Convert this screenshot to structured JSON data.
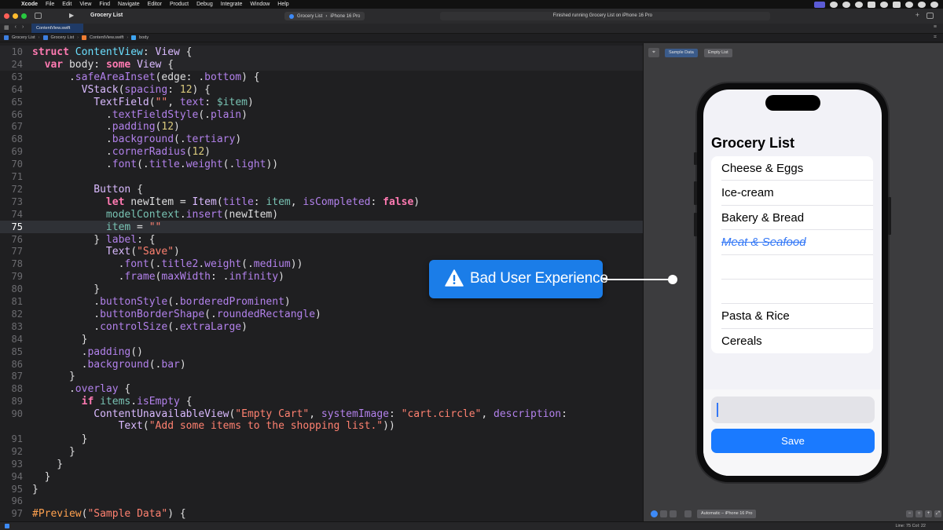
{
  "menubar": {
    "app": "Xcode",
    "items": [
      "File",
      "Edit",
      "View",
      "Find",
      "Navigate",
      "Editor",
      "Product",
      "Debug",
      "Integrate",
      "Window",
      "Help"
    ]
  },
  "toolbar": {
    "project": "Grocery List",
    "scheme": "Grocery List",
    "destination": "iPhone 16 Pro",
    "status": "Finished running Grocery List on iPhone 16 Pro"
  },
  "tabbar": {
    "tab": "ContentView.swift"
  },
  "jumpbar": {
    "crumbs": [
      "Grocery List",
      "Grocery List",
      "ContentView.swift",
      "body"
    ]
  },
  "editor": {
    "current_line": 75,
    "lines": [
      {
        "n": "10",
        "sticky": true,
        "parts": [
          [
            "kw",
            "struct"
          ],
          [
            "",
            ""
          ],
          [
            "tp",
            " ContentView"
          ],
          [
            "",
            ": "
          ],
          [
            "ty",
            "View"
          ],
          [
            "",
            " {"
          ]
        ]
      },
      {
        "n": "24",
        "sticky": true,
        "parts": [
          [
            "",
            "  "
          ],
          [
            "kw",
            "var"
          ],
          [
            "",
            " body: "
          ],
          [
            "kw",
            "some"
          ],
          [
            "ty",
            " View"
          ],
          [
            "",
            " {"
          ]
        ]
      },
      {
        "n": "63",
        "parts": [
          [
            "",
            "      ."
          ],
          [
            "mt",
            "safeAreaInset"
          ],
          [
            "",
            "(edge: ."
          ],
          [
            "mt",
            "bottom"
          ],
          [
            "",
            ") {"
          ]
        ]
      },
      {
        "n": "64",
        "parts": [
          [
            "",
            "        "
          ],
          [
            "ty",
            "VStack"
          ],
          [
            "",
            "("
          ],
          [
            "mt",
            "spacing"
          ],
          [
            "",
            ": "
          ],
          [
            "nm",
            "12"
          ],
          [
            "",
            ") {"
          ]
        ]
      },
      {
        "n": "65",
        "parts": [
          [
            "",
            "          "
          ],
          [
            "ty",
            "TextField"
          ],
          [
            "",
            "("
          ],
          [
            "st",
            "\"\""
          ],
          [
            "",
            ", "
          ],
          [
            "mt",
            "text"
          ],
          [
            "",
            ": "
          ],
          [
            "dp",
            "$item"
          ],
          [
            "",
            ")"
          ]
        ]
      },
      {
        "n": "66",
        "parts": [
          [
            "",
            "            ."
          ],
          [
            "mt",
            "textFieldStyle"
          ],
          [
            "",
            "(."
          ],
          [
            "mt",
            "plain"
          ],
          [
            "",
            ")"
          ]
        ]
      },
      {
        "n": "67",
        "parts": [
          [
            "",
            "            ."
          ],
          [
            "mt",
            "padding"
          ],
          [
            "",
            "("
          ],
          [
            "nm",
            "12"
          ],
          [
            "",
            ")"
          ]
        ]
      },
      {
        "n": "68",
        "parts": [
          [
            "",
            "            ."
          ],
          [
            "mt",
            "background"
          ],
          [
            "",
            "(."
          ],
          [
            "mt",
            "tertiary"
          ],
          [
            "",
            ")"
          ]
        ]
      },
      {
        "n": "69",
        "parts": [
          [
            "",
            "            ."
          ],
          [
            "mt",
            "cornerRadius"
          ],
          [
            "",
            "("
          ],
          [
            "nm",
            "12"
          ],
          [
            "",
            ")"
          ]
        ]
      },
      {
        "n": "70",
        "parts": [
          [
            "",
            "            ."
          ],
          [
            "mt",
            "font"
          ],
          [
            "",
            "(."
          ],
          [
            "mt",
            "title"
          ],
          [
            "",
            "."
          ],
          [
            "mt",
            "weight"
          ],
          [
            "",
            "(."
          ],
          [
            "mt",
            "light"
          ],
          [
            "",
            "))"
          ]
        ]
      },
      {
        "n": "71",
        "parts": [
          [
            "",
            ""
          ]
        ]
      },
      {
        "n": "72",
        "parts": [
          [
            "",
            "          "
          ],
          [
            "ty",
            "Button"
          ],
          [
            "",
            " {"
          ]
        ]
      },
      {
        "n": "73",
        "parts": [
          [
            "",
            "            "
          ],
          [
            "kw",
            "let"
          ],
          [
            "",
            " newItem = "
          ],
          [
            "ty",
            "Item"
          ],
          [
            "",
            "("
          ],
          [
            "mt",
            "title"
          ],
          [
            "",
            ": "
          ],
          [
            "dp",
            "item"
          ],
          [
            "",
            ", "
          ],
          [
            "mt",
            "isCompleted"
          ],
          [
            "",
            ": "
          ],
          [
            "kw",
            "false"
          ],
          [
            "",
            ")"
          ]
        ]
      },
      {
        "n": "74",
        "parts": [
          [
            "",
            "            "
          ],
          [
            "dp",
            "modelContext"
          ],
          [
            "",
            "."
          ],
          [
            "mt",
            "insert"
          ],
          [
            "",
            "(newItem)"
          ]
        ]
      },
      {
        "n": "75",
        "current": true,
        "parts": [
          [
            "",
            "            "
          ],
          [
            "dp",
            "item"
          ],
          [
            "",
            " = "
          ],
          [
            "st",
            "\"\""
          ]
        ]
      },
      {
        "n": "76",
        "parts": [
          [
            "",
            "          } "
          ],
          [
            "mt",
            "label"
          ],
          [
            "",
            ": {"
          ]
        ]
      },
      {
        "n": "77",
        "parts": [
          [
            "",
            "            "
          ],
          [
            "ty",
            "Text"
          ],
          [
            "",
            "("
          ],
          [
            "st",
            "\"Save\""
          ],
          [
            "",
            ")"
          ]
        ]
      },
      {
        "n": "78",
        "parts": [
          [
            "",
            "              ."
          ],
          [
            "mt",
            "font"
          ],
          [
            "",
            "(."
          ],
          [
            "mt",
            "title2"
          ],
          [
            "",
            "."
          ],
          [
            "mt",
            "weight"
          ],
          [
            "",
            "(."
          ],
          [
            "mt",
            "medium"
          ],
          [
            "",
            "))"
          ]
        ]
      },
      {
        "n": "79",
        "parts": [
          [
            "",
            "              ."
          ],
          [
            "mt",
            "frame"
          ],
          [
            "",
            "("
          ],
          [
            "mt",
            "maxWidth"
          ],
          [
            "",
            ": ."
          ],
          [
            "mt",
            "infinity"
          ],
          [
            "",
            ")"
          ]
        ]
      },
      {
        "n": "80",
        "parts": [
          [
            "",
            "          }"
          ]
        ]
      },
      {
        "n": "81",
        "parts": [
          [
            "",
            "          ."
          ],
          [
            "mt",
            "buttonStyle"
          ],
          [
            "",
            "(."
          ],
          [
            "mt",
            "borderedProminent"
          ],
          [
            "",
            ")"
          ]
        ]
      },
      {
        "n": "82",
        "parts": [
          [
            "",
            "          ."
          ],
          [
            "mt",
            "buttonBorderShape"
          ],
          [
            "",
            "(."
          ],
          [
            "mt",
            "roundedRectangle"
          ],
          [
            "",
            ")"
          ]
        ]
      },
      {
        "n": "83",
        "parts": [
          [
            "",
            "          ."
          ],
          [
            "mt",
            "controlSize"
          ],
          [
            "",
            "(."
          ],
          [
            "mt",
            "extraLarge"
          ],
          [
            "",
            ")"
          ]
        ]
      },
      {
        "n": "84",
        "parts": [
          [
            "",
            "        }"
          ]
        ]
      },
      {
        "n": "85",
        "parts": [
          [
            "",
            "        ."
          ],
          [
            "mt",
            "padding"
          ],
          [
            "",
            "()"
          ]
        ]
      },
      {
        "n": "86",
        "parts": [
          [
            "",
            "        ."
          ],
          [
            "mt",
            "background"
          ],
          [
            "",
            "(."
          ],
          [
            "mt",
            "bar"
          ],
          [
            "",
            ")"
          ]
        ]
      },
      {
        "n": "87",
        "parts": [
          [
            "",
            "      }"
          ]
        ]
      },
      {
        "n": "88",
        "parts": [
          [
            "",
            "      ."
          ],
          [
            "mt",
            "overlay"
          ],
          [
            "",
            " {"
          ]
        ]
      },
      {
        "n": "89",
        "parts": [
          [
            "",
            "        "
          ],
          [
            "kw",
            "if"
          ],
          [
            "",
            " "
          ],
          [
            "dp",
            "items"
          ],
          [
            "",
            "."
          ],
          [
            "mt",
            "isEmpty"
          ],
          [
            "",
            " {"
          ]
        ]
      },
      {
        "n": "90",
        "parts": [
          [
            "",
            "          "
          ],
          [
            "ty",
            "ContentUnavailableView"
          ],
          [
            "",
            "("
          ],
          [
            "st",
            "\"Empty Cart\""
          ],
          [
            "",
            ", "
          ],
          [
            "mt",
            "systemImage"
          ],
          [
            "",
            ": "
          ],
          [
            "st",
            "\"cart.circle\""
          ],
          [
            "",
            ", "
          ],
          [
            "mt",
            "description"
          ],
          [
            "",
            ":"
          ]
        ]
      },
      {
        "n": "",
        "parts": [
          [
            "",
            "              "
          ],
          [
            "ty",
            "Text"
          ],
          [
            "",
            "("
          ],
          [
            "st",
            "\"Add some items to the shopping list.\""
          ],
          [
            "",
            "))"
          ]
        ]
      },
      {
        "n": "91",
        "parts": [
          [
            "",
            "        }"
          ]
        ]
      },
      {
        "n": "92",
        "parts": [
          [
            "",
            "      }"
          ]
        ]
      },
      {
        "n": "93",
        "parts": [
          [
            "",
            "    }"
          ]
        ]
      },
      {
        "n": "94",
        "parts": [
          [
            "",
            "  }"
          ]
        ]
      },
      {
        "n": "95",
        "parts": [
          [
            "",
            "}"
          ]
        ]
      },
      {
        "n": "96",
        "parts": [
          [
            "",
            ""
          ]
        ]
      },
      {
        "n": "97",
        "parts": [
          [
            "at",
            "#Preview"
          ],
          [
            "",
            "("
          ],
          [
            "st",
            "\"Sample Data\""
          ],
          [
            "",
            ") {"
          ]
        ]
      }
    ]
  },
  "canvas": {
    "previews": [
      "Sample Data",
      "Empty List"
    ],
    "selected_preview": "Sample Data",
    "device": "Automatic – iPhone 16 Pro"
  },
  "phone": {
    "title": "Grocery List",
    "items": [
      {
        "title": "Cheese & Eggs",
        "completed": false
      },
      {
        "title": "Ice-cream",
        "completed": false
      },
      {
        "title": "Bakery & Bread",
        "completed": false
      },
      {
        "title": "Meat & Seafood",
        "completed": true
      },
      {
        "title": "",
        "completed": false
      },
      {
        "title": "",
        "completed": false
      },
      {
        "title": "Pasta & Rice",
        "completed": false
      },
      {
        "title": "Cereals",
        "completed": false
      }
    ],
    "save_label": "Save"
  },
  "callout": {
    "text": "Bad User Experience"
  },
  "statusbar": {
    "position": "Line: 75  Col: 22"
  },
  "colors": {
    "accent": "#1a7aff",
    "callout": "#1b7de8",
    "completed_item": "#3478f6"
  }
}
